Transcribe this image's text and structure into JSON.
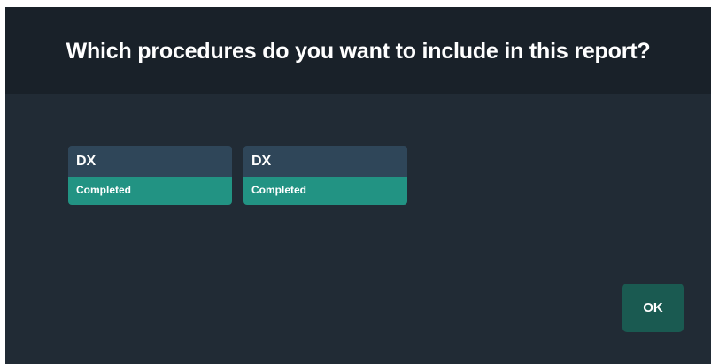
{
  "dialog": {
    "title": "Which procedures do you want to include in this report?",
    "ok_label": "OK"
  },
  "procedures": [
    {
      "modality": "DX",
      "status": "Completed"
    },
    {
      "modality": "DX",
      "status": "Completed"
    }
  ],
  "colors": {
    "dialog_background": "#212b35",
    "header_background": "#192129",
    "card_header": "#2f4659",
    "status_completed": "#229383",
    "ok_button": "#1a5a51"
  }
}
